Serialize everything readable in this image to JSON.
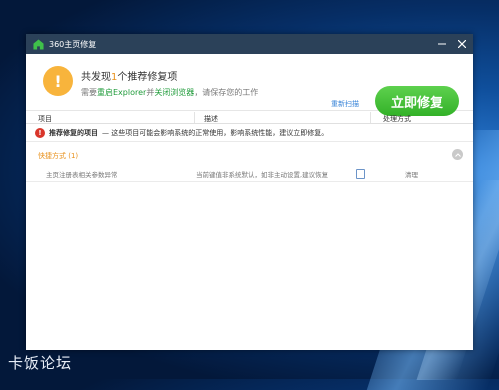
{
  "window": {
    "title": "360主页修复"
  },
  "summary": {
    "found_prefix": "共发现",
    "found_count": "1",
    "found_suffix": "个推荐修复项",
    "hint_1": "需要",
    "hint_action_1": "重启Explorer",
    "hint_2": "并",
    "hint_action_2": "关闭浏览器",
    "hint_3": "，请保存您的工作",
    "rescan_label": "重新扫描",
    "fix_button_label": "立即修复"
  },
  "table": {
    "headers": [
      "项目",
      "描述",
      "处理方式"
    ]
  },
  "recommend": {
    "label": "推荐修复的项目",
    "description": "— 这些项目可能会影响系统的正常使用，影响系统性能，建议立即修复。"
  },
  "groups": [
    {
      "name": "快捷方式 (1)",
      "rows": [
        {
          "item": "主页注册表相关参数异常",
          "description": "当前键值非系统默认，如非主动设置,建议恢复",
          "action": "清理"
        }
      ]
    }
  ],
  "watermark": "卡饭论坛",
  "colors": {
    "titlebar": "#2b4159",
    "fix_button": "#3fbf2f",
    "warning": "#f8b43c",
    "accent_orange": "#e8911c",
    "link_blue": "#3a85d8"
  }
}
